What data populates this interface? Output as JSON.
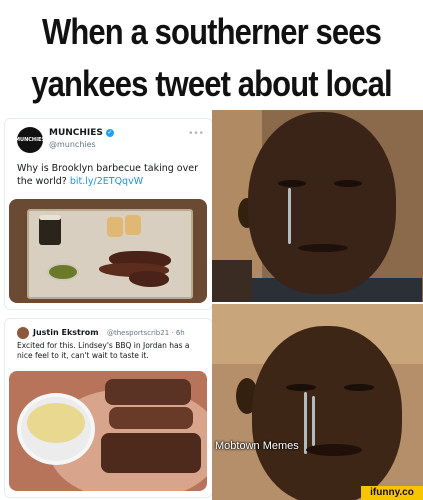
{
  "caption": {
    "line1": "When a southerner sees",
    "line2": "yankees tweet about local BBQ."
  },
  "tweet1": {
    "avatar_text": "MUNCHIES",
    "name": "MUNCHIES",
    "verified_icon": "verified-check-icon",
    "handle": "@munchies",
    "text": "Why is Brooklyn barbecue taking over the world?",
    "link": "bit.ly/2ETQqvW",
    "more_icon": "more-dots-icon"
  },
  "tweet2": {
    "name": "Justin Ekstrom",
    "handle": "@thesportscrib21 · 6h",
    "text": "Excited for this. Lindsey's BBQ in Jordan has a nice feel to it, can't wait to taste it."
  },
  "watermark": "Mobtown Memes",
  "brand_badge": "ifunny.co",
  "colors": {
    "twitter_link": "#1b95e0",
    "verified": "#1da1f2",
    "ifunny_yellow": "#f7c600"
  }
}
